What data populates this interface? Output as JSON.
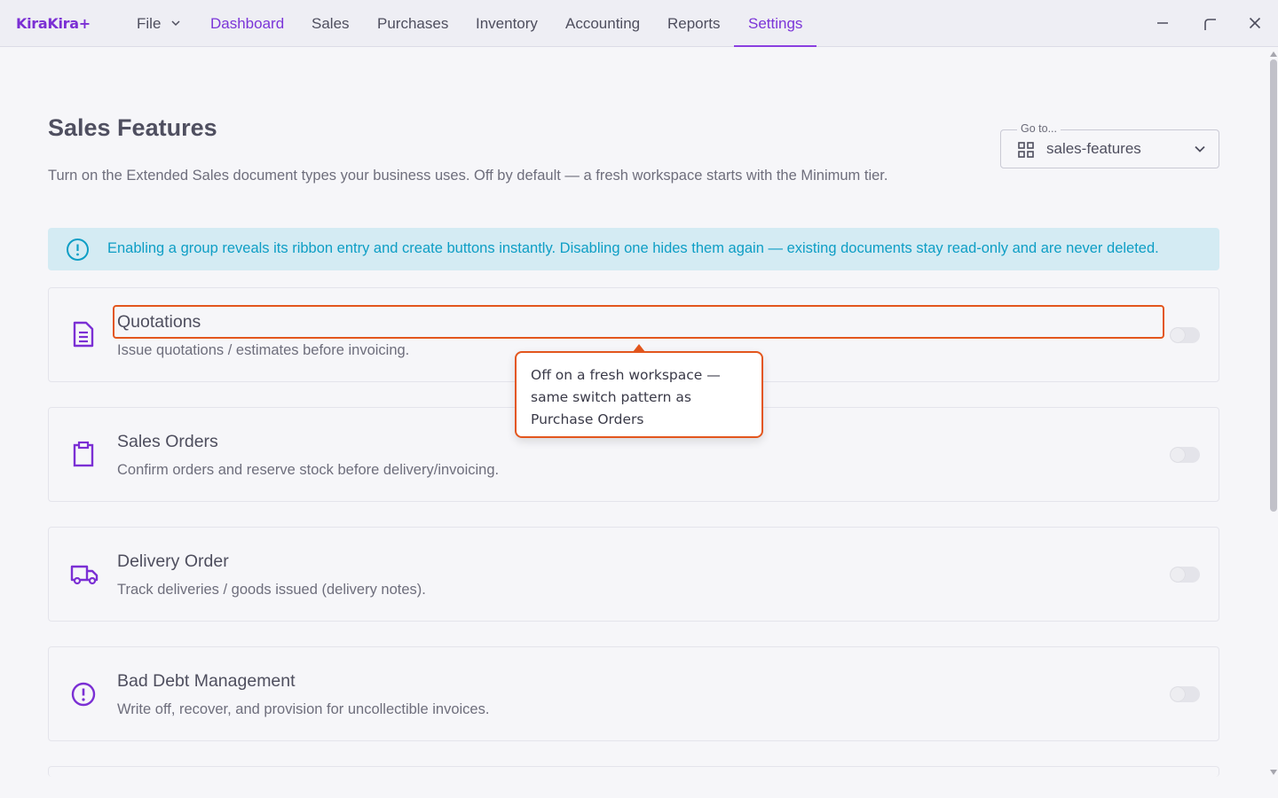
{
  "app": {
    "logo": "KiraKira+"
  },
  "menu": {
    "file": "File",
    "items": [
      {
        "label": "Dashboard"
      },
      {
        "label": "Sales"
      },
      {
        "label": "Purchases"
      },
      {
        "label": "Inventory"
      },
      {
        "label": "Accounting"
      },
      {
        "label": "Reports"
      },
      {
        "label": "Settings"
      }
    ],
    "selected": "Settings"
  },
  "window_controls": [
    "minimize-icon",
    "restore-icon",
    "close-icon"
  ],
  "page": {
    "title": "Sales Features",
    "description": "Turn on the Extended Sales document types your business uses. Off by default — a fresh workspace starts with the Minimum tier."
  },
  "goto": {
    "label": "Go to...",
    "value": "sales-features",
    "icon": "grid-icon"
  },
  "banner": {
    "icon": "info-icon",
    "text": "Enabling a group reveals its ribbon entry and create buttons instantly. Disabling one hides them again — existing documents stay read-only and are never deleted."
  },
  "features": [
    {
      "title": "Quotations",
      "subtitle": "Issue quotations / estimates before invoicing.",
      "icon": "document-icon",
      "enabled": false
    },
    {
      "title": "Sales Orders",
      "subtitle": "Confirm orders and reserve stock before delivery/invoicing.",
      "icon": "clipboard-icon",
      "enabled": false
    },
    {
      "title": "Delivery Order",
      "subtitle": "Track deliveries / goods issued (delivery notes).",
      "icon": "truck-icon",
      "enabled": false
    },
    {
      "title": "Bad Debt Management",
      "subtitle": "Write off, recover, and provision for uncollectible invoices.",
      "icon": "alert-circle-icon",
      "enabled": false
    }
  ],
  "tooltip": {
    "text": "Off on a fresh workspace — same switch pattern as Purchase Orders"
  },
  "colors": {
    "accent": "#7b35d8",
    "highlight": "#e3561d",
    "banner_bg": "#d4ebf3",
    "banner_text": "#0e9ec5"
  }
}
